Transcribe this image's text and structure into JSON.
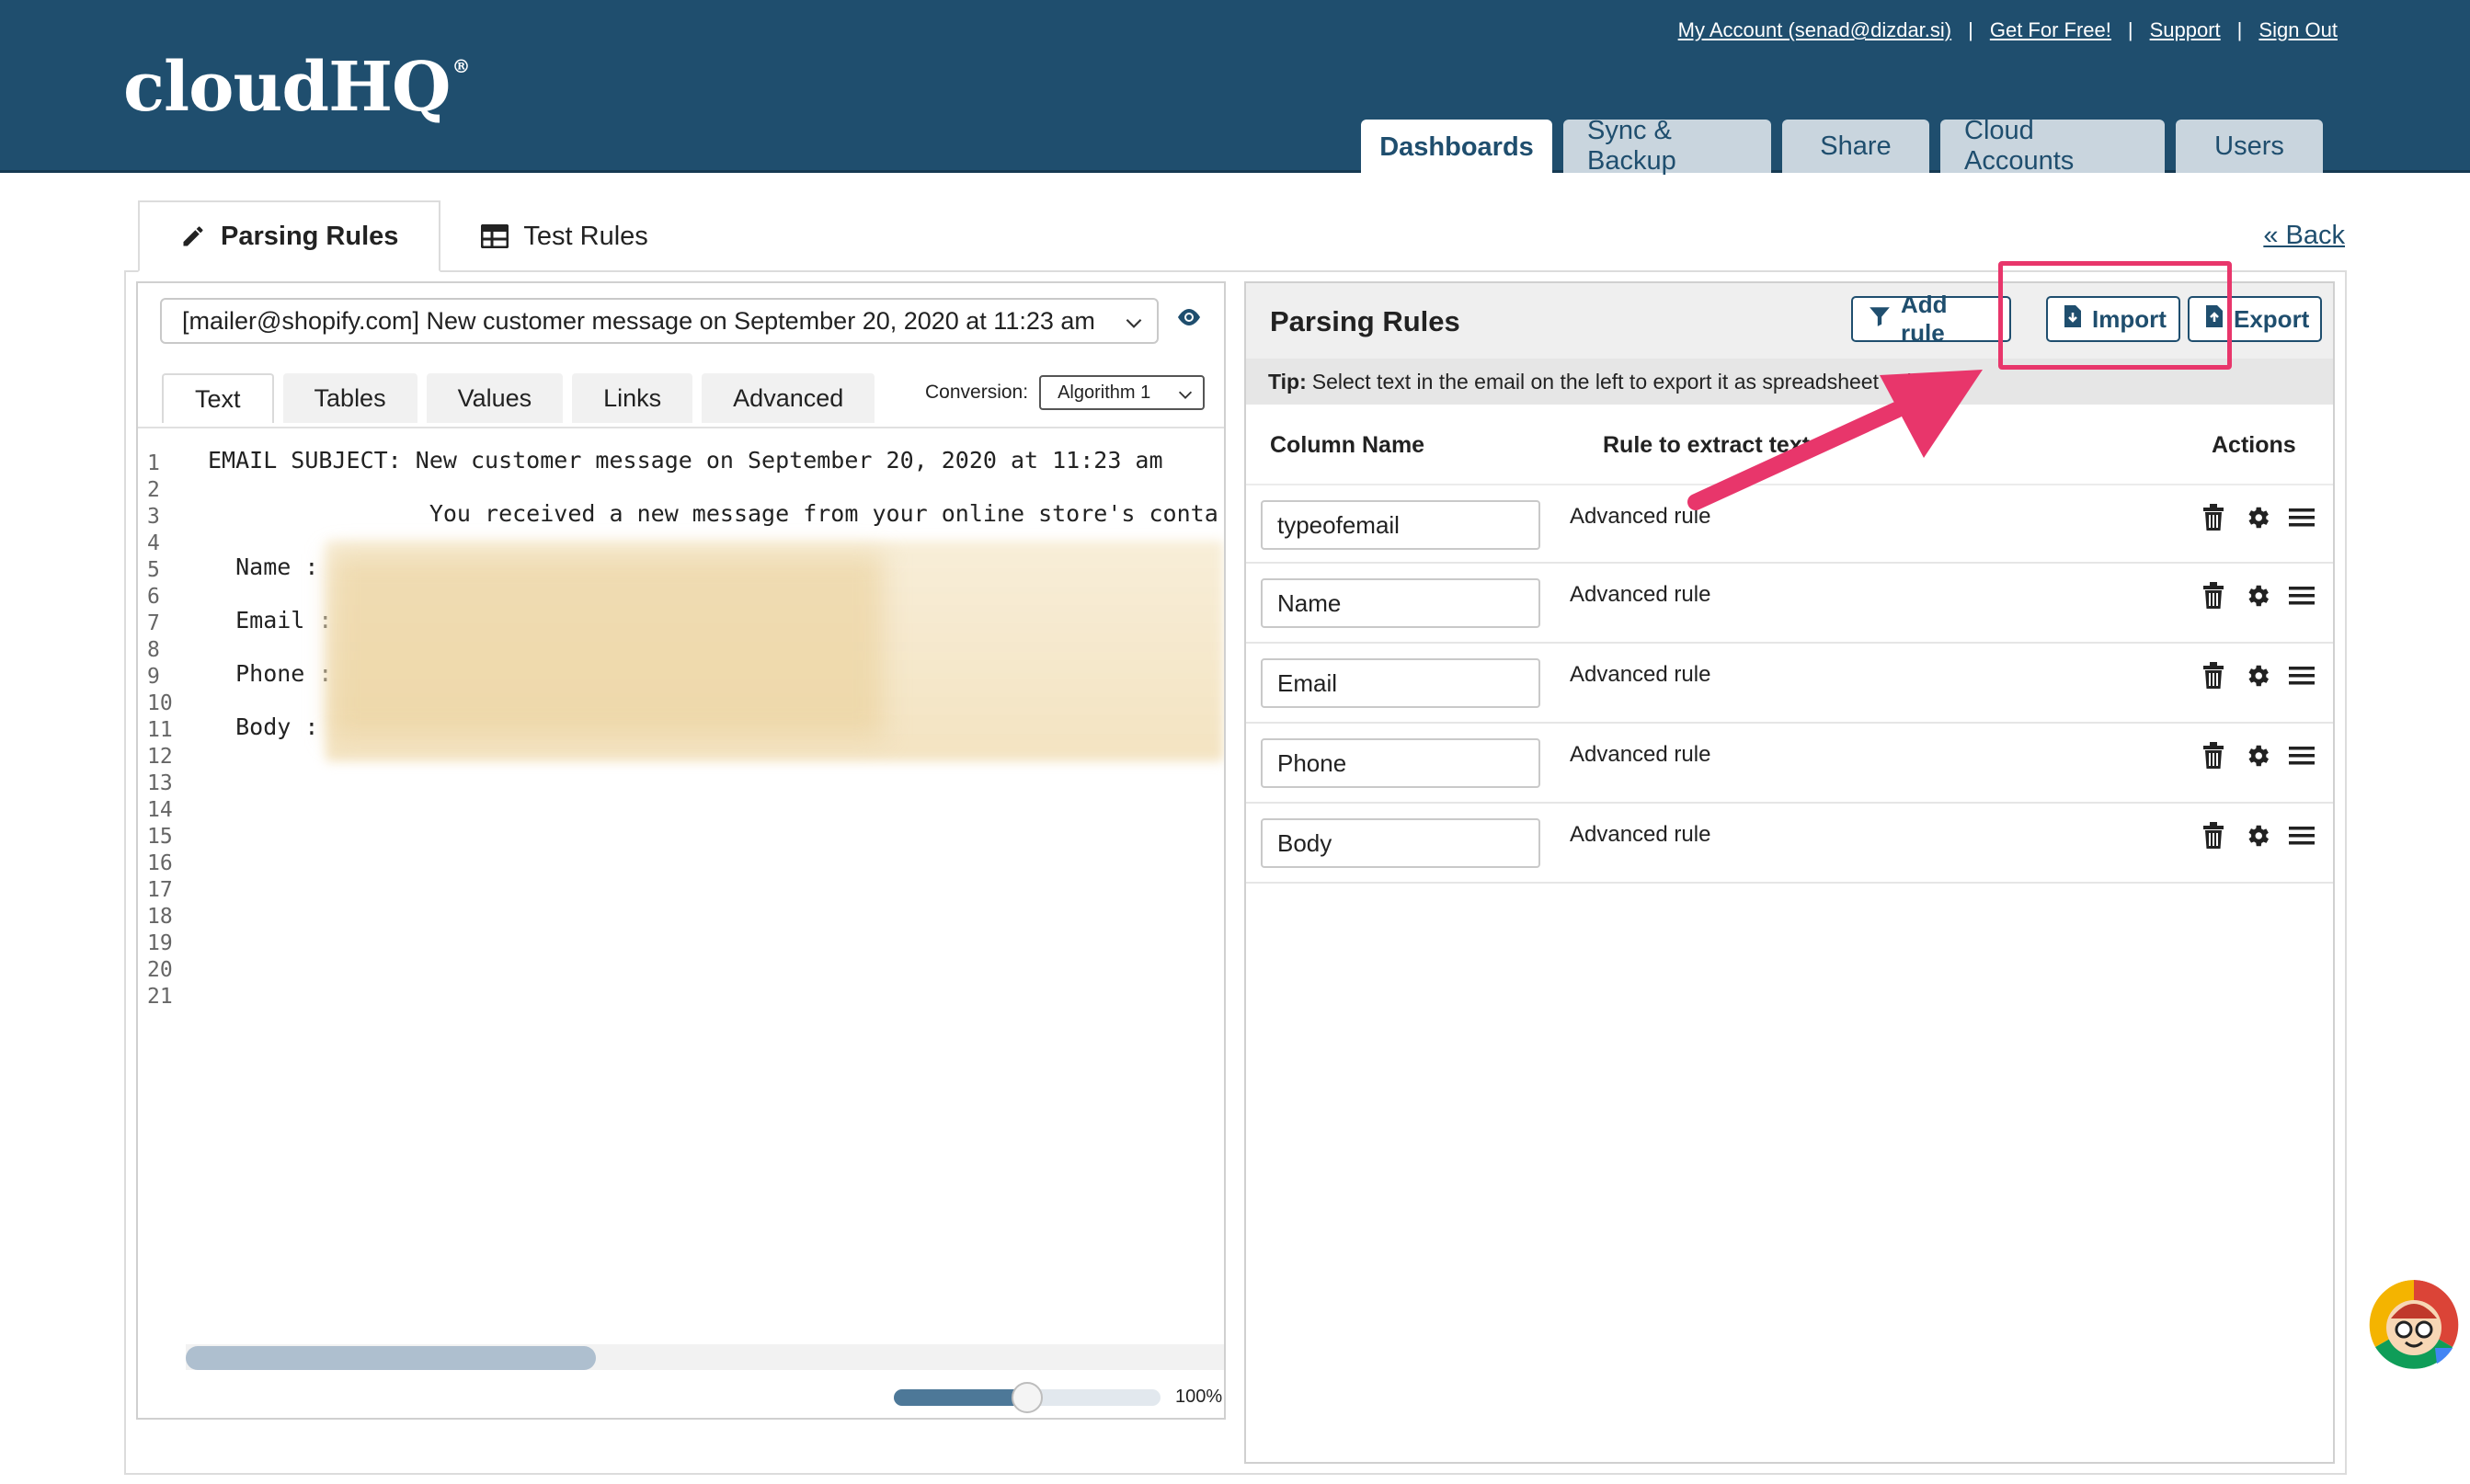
{
  "header": {
    "logo": "cloudHQ",
    "logo_mark": "®",
    "links": {
      "account": "My Account (senad@dizdar.si)",
      "get_free": "Get For Free!",
      "support": "Support",
      "sign_out": "Sign Out",
      "separator": "|"
    },
    "tabs": {
      "dashboards": "Dashboards",
      "sync_backup": "Sync & Backup",
      "share": "Share",
      "cloud_accounts": "Cloud Accounts",
      "users": "Users"
    }
  },
  "subtabs": {
    "parsing_rules": "Parsing Rules",
    "test_rules": "Test Rules",
    "back": "« Back"
  },
  "left_panel": {
    "email_select_value": "[mailer@shopify.com] New customer message on September 20, 2020 at 11:23 am",
    "tabs": {
      "text": "Text",
      "tables": "Tables",
      "values": "Values",
      "links": "Links",
      "advanced": "Advanced"
    },
    "conversion_label": "Conversion:",
    "conversion_value": "Algorithm 1",
    "line_numbers": [
      "1",
      "2",
      "3",
      "4",
      "5",
      "6",
      "7",
      "8",
      "9",
      "10",
      "11",
      "12",
      "13",
      "14",
      "15",
      "16",
      "17",
      "18",
      "19",
      "20",
      "21"
    ],
    "code_lines": [
      "EMAIL SUBJECT: New customer message on September 20, 2020 at 11:23 am",
      "",
      "                You received a new message from your online store's contact form.",
      "",
      "  Name :",
      "",
      "  Email :",
      "",
      "  Phone :",
      "",
      "  Body :"
    ],
    "zoom_label": "100%",
    "zoom_value": 0.5
  },
  "right_panel": {
    "title": "Parsing Rules",
    "buttons": {
      "add_rule": "Add rule",
      "import": "Import",
      "export": "Export"
    },
    "tip_label": "Tip:",
    "tip_text": "Select text in the email on the left to export it as spreadsheet col",
    "columns": {
      "name": "Column Name",
      "rule": "Rule to extract text",
      "actions": "Actions"
    },
    "rules": [
      {
        "name": "typeofemail",
        "rule": "Advanced rule"
      },
      {
        "name": "Name",
        "rule": "Advanced rule"
      },
      {
        "name": "Email",
        "rule": "Advanced rule"
      },
      {
        "name": "Phone",
        "rule": "Advanced rule"
      },
      {
        "name": "Body",
        "rule": "Advanced rule"
      }
    ]
  },
  "colors": {
    "header_bg": "#1f4e6e",
    "accent": "#1f4e6e",
    "annotation": "#e8366b"
  },
  "icons": {
    "subtab_parsing": "pencil-icon",
    "subtab_test": "table-icon",
    "preview": "eye-icon",
    "add_rule": "filter-icon",
    "import": "file-import-icon",
    "export": "file-export-icon",
    "delete": "trash-icon",
    "settings": "gear-icon",
    "reorder": "menu-icon"
  }
}
